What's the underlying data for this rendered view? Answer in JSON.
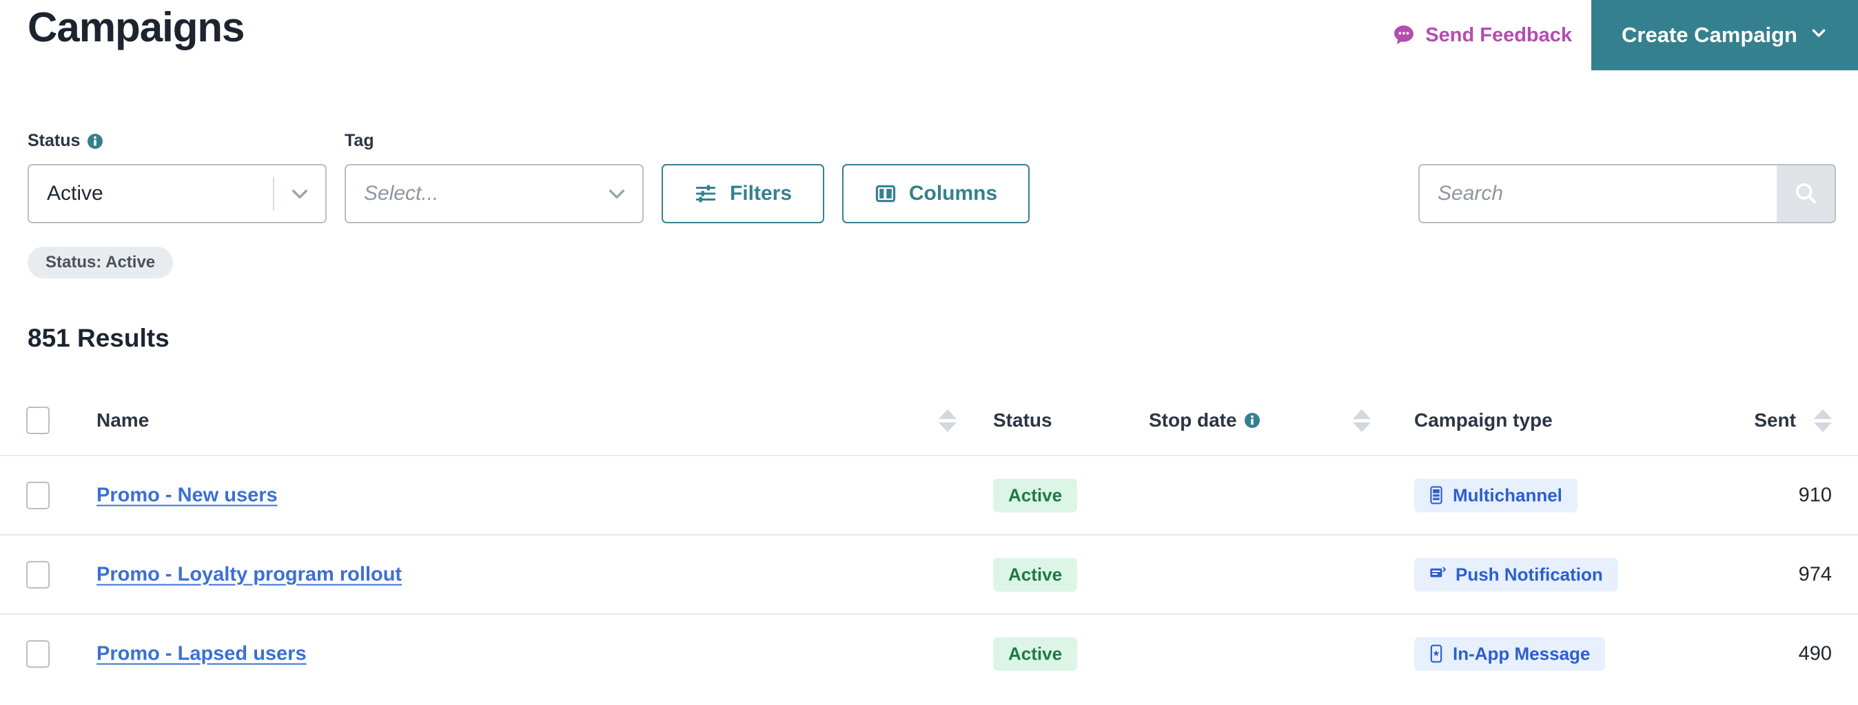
{
  "header": {
    "title": "Campaigns",
    "feedback_label": "Send Feedback",
    "feedback_icon": "speech-bubble-icon",
    "create_label": "Create Campaign",
    "create_caret": "⌄",
    "accent_color": "#35808f",
    "feedback_color": "#b54cb0"
  },
  "filters": {
    "status": {
      "label": "Status",
      "info_icon": "info-icon",
      "value": "Active"
    },
    "tag": {
      "label": "Tag",
      "placeholder": "Select..."
    },
    "filters_button": {
      "label": "Filters",
      "icon": "sliders-icon"
    },
    "columns_button": {
      "label": "Columns",
      "icon": "columns-icon"
    },
    "search": {
      "placeholder": "Search",
      "value": "",
      "icon": "search-icon"
    },
    "chips": [
      {
        "label": "Status: Active"
      }
    ]
  },
  "results": {
    "count_label": "851 Results"
  },
  "table": {
    "columns": [
      {
        "key": "select",
        "label": "",
        "sortable": false
      },
      {
        "key": "name",
        "label": "Name",
        "sortable": true
      },
      {
        "key": "status",
        "label": "Status",
        "sortable": false
      },
      {
        "key": "stop",
        "label": "Stop date",
        "sortable": true,
        "info_icon": "info-icon"
      },
      {
        "key": "type",
        "label": "Campaign type",
        "sortable": false
      },
      {
        "key": "sent",
        "label": "Sent",
        "sortable": true
      }
    ],
    "rows": [
      {
        "name": "Promo - New users",
        "status": "Active",
        "stop_date": "",
        "campaign_type": "Multichannel",
        "campaign_type_icon": "multichannel-icon",
        "sent": "910"
      },
      {
        "name": "Promo - Loyalty program rollout",
        "status": "Active",
        "stop_date": "",
        "campaign_type": "Push Notification",
        "campaign_type_icon": "push-notification-icon",
        "sent": "974"
      },
      {
        "name": "Promo - Lapsed users",
        "status": "Active",
        "stop_date": "",
        "campaign_type": "In-App Message",
        "campaign_type_icon": "in-app-message-icon",
        "sent": "490"
      }
    ]
  }
}
